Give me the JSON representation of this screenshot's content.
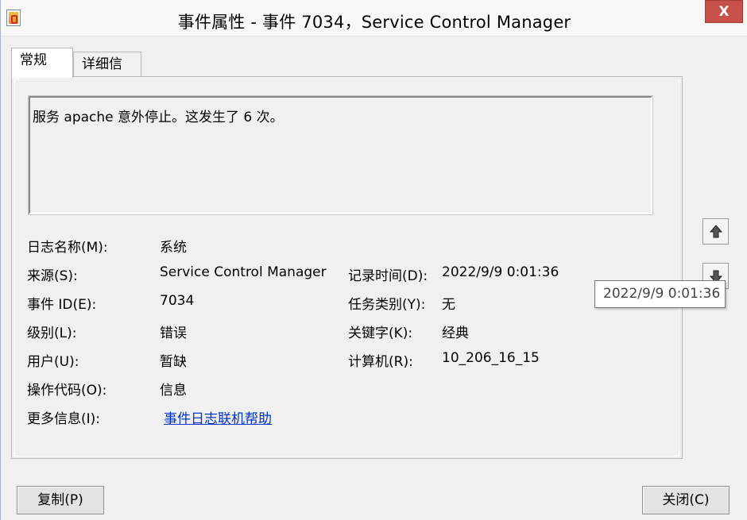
{
  "window": {
    "title": "事件属性 - 事件 7034，Service Control Manager",
    "close_label": "X"
  },
  "tabs": [
    {
      "label": "常规",
      "active": true
    },
    {
      "label": "详细信息",
      "active": false
    }
  ],
  "description": "服务 apache 意外停止。这发生了 6 次。",
  "fields": {
    "log_name": {
      "label": "日志名称(M):",
      "value": "系统"
    },
    "source": {
      "label": "来源(S):",
      "value": "Service Control Manager"
    },
    "logged": {
      "label": "记录时间(D):",
      "value": "2022/9/9 0:01:36"
    },
    "event_id": {
      "label": "事件 ID(E):",
      "value": "7034"
    },
    "task_category": {
      "label": "任务类别(Y):",
      "value": "无"
    },
    "level": {
      "label": "级别(L):",
      "value": "错误"
    },
    "keywords": {
      "label": "关键字(K):",
      "value": "经典"
    },
    "user": {
      "label": "用户(U):",
      "value": "暂缺"
    },
    "computer": {
      "label": "计算机(R):",
      "value": "10_206_16_15"
    },
    "opcode": {
      "label": "操作代码(O):",
      "value": "信息"
    },
    "more_info": {
      "label": "更多信息(I):",
      "value": "事件日志联机帮助"
    }
  },
  "tooltip": "2022/9/9 0:01:36",
  "buttons": {
    "copy": "复制(P)",
    "close": "关闭(C)"
  },
  "icons": {
    "up": "arrow-up-icon",
    "down": "arrow-down-icon"
  }
}
